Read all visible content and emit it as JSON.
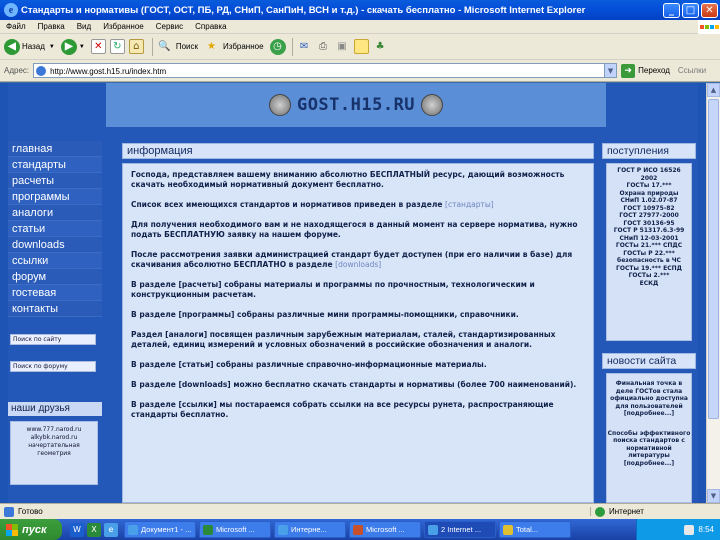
{
  "window": {
    "title": "Стандарты и нормативы (ГОСТ, ОСТ, ПБ, РД, СНиП, СанПиН, ВСН и т.д.) - скачать бесплатно - Microsoft Internet Explorer",
    "minimize": "_",
    "maximize": "□",
    "close": "✕"
  },
  "menu": [
    "Файл",
    "Правка",
    "Вид",
    "Избранное",
    "Сервис",
    "Справка"
  ],
  "toolbar": {
    "back": "Назад",
    "search": "Поиск",
    "favorites": "Избранное"
  },
  "address": {
    "label": "Адрес:",
    "url": "http://www.gost.h15.ru/index.htm",
    "go": "Переход",
    "links": "Ссылки"
  },
  "site": {
    "logo": "GOST.H15.RU",
    "nav": [
      "главная",
      "стандарты",
      "расчеты",
      "программы",
      "аналоги",
      "статьи",
      "downloads",
      "ссылки",
      "форум",
      "гостевая",
      "контакты"
    ],
    "search_site": "Поиск по сайту",
    "search_forum": "Поиск по форуму",
    "friends_title": "наши друзья",
    "friends_text": [
      "www.777.narod.ru",
      "alkybk.narod.ru",
      "начертательная",
      "геометрия"
    ],
    "main_title": "информация",
    "paragraphs": [
      {
        "text": "Господа, представляем вашему вниманию абсолютно БЕСПЛАТНЫЙ ресурс, дающий возможность скачать необходимый нормативный документ бесплатно.",
        "link": ""
      },
      {
        "text": "Список всех имеющихся стандартов и нормативов приведен в разделе ",
        "link": "[стандарты]"
      },
      {
        "text": "Для получения необходимого вам и не находящегося в данный момент на сервере норматива, нужно подать БЕСПЛАТНУЮ заявку на нашем форуме.",
        "link": ""
      },
      {
        "text": "После рассмотрения заявки администрацией стандарт будет доступен (при его наличии в базе) для скачивания абсолютно БЕСПЛАТНО в разделе ",
        "link": "[downloads]"
      },
      {
        "text": "В разделе [расчеты] собраны материалы и программы по прочностным, технологическим и конструкционным расчетам.",
        "link": ""
      },
      {
        "text": "В разделе [программы] собраны различные мини программы-помощники, справочники.",
        "link": ""
      },
      {
        "text": "Раздел [аналоги] посвящен различным зарубежным материалам, сталей, стандартизированных деталей, единиц измерений и условных обозначений в российские обозначения и аналоги.",
        "link": ""
      },
      {
        "text": "В разделе [статьи] собраны различные справочно-информационные материалы.",
        "link": ""
      },
      {
        "text": "В разделе [downloads] можно бесплатно скачать стандарты и нормативы (более 700 наименований).",
        "link": ""
      },
      {
        "text": "В разделе [ссылки] мы постараемся собрать ссылки на все ресурсы рунета, распространяющие стандарты бесплатно.",
        "link": ""
      }
    ],
    "arrivals_title": "поступления",
    "arrivals": [
      "ГОСТ Р ИСО 16526",
      "2002",
      "ГОСТы 17.***",
      "Охрана природы",
      "СНиП 1.02.07-87",
      "ГОСТ 10975-82",
      "ГОСТ 27977-2000",
      "ГОСТ 30136-95",
      "ГОСТ Р 51317.6.3-99",
      "СНиП 12-03-2001",
      "ГОСТы 21.*** СПДС",
      "ГОСТы Р 22.***",
      "безопасность в ЧС",
      "ГОСТы 19.*** ЕСПД",
      "ГОСТы 2.***",
      "ЕСКД"
    ],
    "news_title": "новости сайта",
    "news": [
      "Финальная точка в деле ГОСТов стала официально доступна для пользователей [подробнее...]",
      "Способы эффективного поиска стандартов с нормативной литературы [подробнее...]"
    ]
  },
  "status": {
    "text": "Готово",
    "zone": "Интернет"
  },
  "taskbar": {
    "start": "пуск",
    "tasks": [
      "Документ1 - ...",
      "Microsoft ...",
      "Интерне...",
      "Microsoft ...",
      "2 Internet ...",
      "Total..."
    ],
    "clock": "8:54"
  },
  "colors": {
    "page_bg": "#2358b8",
    "panel_bg": "#d8e4f8",
    "nav_bg": "#2f62c0"
  }
}
